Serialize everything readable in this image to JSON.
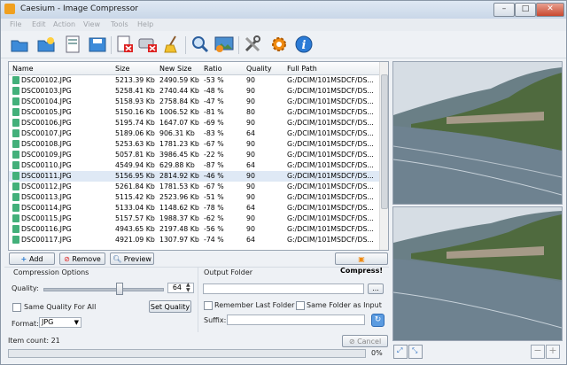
{
  "window": {
    "title": "Caesium - Image Compressor",
    "minimize": "–",
    "maximize": "□",
    "close": "✕"
  },
  "menu": [
    "File",
    "Edit",
    "Action",
    "View",
    "Tools",
    "Help"
  ],
  "toolbar_icons": [
    "open-folder-icon",
    "new-folder-icon",
    "document-icon",
    "save-icon",
    "remove-item-icon",
    "clear-list-icon",
    "broom-icon",
    "search-icon",
    "image-preview-icon",
    "tools-icon",
    "settings-gear-icon",
    "info-icon"
  ],
  "list": {
    "headers": [
      "Name",
      "Size",
      "New Size",
      "Ratio",
      "Quality",
      "Full Path"
    ],
    "rows": [
      [
        "DSC00102.JPG",
        "5213.39 Kb",
        "2490.59 Kb",
        "-53 %",
        "90",
        "G:/DCIM/101MSDCF/DS..."
      ],
      [
        "DSC00103.JPG",
        "5258.41 Kb",
        "2740.44 Kb",
        "-48 %",
        "90",
        "G:/DCIM/101MSDCF/DS..."
      ],
      [
        "DSC00104.JPG",
        "5158.93 Kb",
        "2758.84 Kb",
        "-47 %",
        "90",
        "G:/DCIM/101MSDCF/DS..."
      ],
      [
        "DSC00105.JPG",
        "5150.16 Kb",
        "1006.52 Kb",
        "-81 %",
        "80",
        "G:/DCIM/101MSDCF/DS..."
      ],
      [
        "DSC00106.JPG",
        "5195.74 Kb",
        "1647.07 Kb",
        "-69 %",
        "90",
        "G:/DCIM/101MSDCF/DS..."
      ],
      [
        "DSC00107.JPG",
        "5189.06 Kb",
        "906.31 Kb",
        "-83 %",
        "64",
        "G:/DCIM/101MSDCF/DS..."
      ],
      [
        "DSC00108.JPG",
        "5253.63 Kb",
        "1781.23 Kb",
        "-67 %",
        "90",
        "G:/DCIM/101MSDCF/DS..."
      ],
      [
        "DSC00109.JPG",
        "5057.81 Kb",
        "3986.45 Kb",
        "-22 %",
        "90",
        "G:/DCIM/101MSDCF/DS..."
      ],
      [
        "DSC00110.JPG",
        "4549.94 Kb",
        "629.88 Kb",
        "-87 %",
        "64",
        "G:/DCIM/101MSDCF/DS..."
      ],
      [
        "DSC00111.JPG",
        "5156.95 Kb",
        "2814.92 Kb",
        "-46 %",
        "90",
        "G:/DCIM/101MSDCF/DS..."
      ],
      [
        "DSC00112.JPG",
        "5261.84 Kb",
        "1781.53 Kb",
        "-67 %",
        "90",
        "G:/DCIM/101MSDCF/DS..."
      ],
      [
        "DSC00113.JPG",
        "5115.42 Kb",
        "2523.96 Kb",
        "-51 %",
        "90",
        "G:/DCIM/101MSDCF/DS..."
      ],
      [
        "DSC00114.JPG",
        "5133.04 Kb",
        "1148.62 Kb",
        "-78 %",
        "64",
        "G:/DCIM/101MSDCF/DS..."
      ],
      [
        "DSC00115.JPG",
        "5157.57 Kb",
        "1988.37 Kb",
        "-62 %",
        "90",
        "G:/DCIM/101MSDCF/DS..."
      ],
      [
        "DSC00116.JPG",
        "4943.65 Kb",
        "2197.48 Kb",
        "-56 %",
        "90",
        "G:/DCIM/101MSDCF/DS..."
      ],
      [
        "DSC00117.JPG",
        "4921.09 Kb",
        "1307.97 Kb",
        "-74 %",
        "64",
        "G:/DCIM/101MSDCF/DS..."
      ]
    ],
    "selected_row": 9
  },
  "actions": {
    "add": "Add",
    "remove": "Remove",
    "preview": "Preview",
    "compress": "Compress!"
  },
  "options": {
    "section": "Compression Options",
    "quality_label": "Quality:",
    "quality_value": "64",
    "quality_level": 64,
    "same_quality": "Same Quality For All",
    "set_quality": "Set Quality",
    "format_label": "Format:",
    "format_value": "JPG"
  },
  "output": {
    "section": "Output Folder",
    "browse": "...",
    "remember": "Remember Last Folder",
    "same_folder": "Same Folder as Input",
    "suffix_label": "Suffix:"
  },
  "status": {
    "item_count": "Item count: 21",
    "cancel": "Cancel",
    "progress": "0%"
  }
}
